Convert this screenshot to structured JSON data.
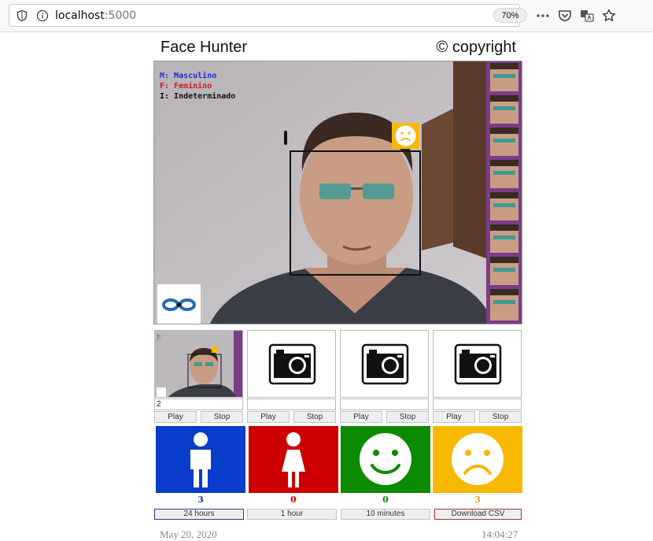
{
  "browser": {
    "url_host": "localhost",
    "url_port": ":5000",
    "zoom": "70%"
  },
  "header": {
    "title": "Face Hunter",
    "copyright": "© copyright"
  },
  "video": {
    "legend": {
      "male": "M: Masculino",
      "female": "F: Feminino",
      "undetermined": "I: Indeterminado"
    },
    "emotion_badge_icon": "sad-face-icon"
  },
  "thumbnails": [
    {
      "input_value": "2",
      "play_label": "Play",
      "stop_label": "Stop"
    },
    {
      "input_value": "",
      "play_label": "Play",
      "stop_label": "Stop"
    },
    {
      "input_value": "",
      "play_label": "Play",
      "stop_label": "Stop"
    },
    {
      "input_value": "",
      "play_label": "Play",
      "stop_label": "Stop"
    }
  ],
  "stats": {
    "male": {
      "count": "3",
      "color": "#0a3ccc",
      "icon": "male-person-icon"
    },
    "female": {
      "count": "0",
      "color": "#cc0000",
      "icon": "female-person-icon"
    },
    "happy": {
      "count": "0",
      "color": "#0c8a00",
      "icon": "happy-face-icon"
    },
    "sad": {
      "count": "3",
      "color": "#f6b900",
      "icon": "sad-face-icon"
    }
  },
  "time_ranges": {
    "day": "24 hours",
    "hour": "1 hour",
    "minutes": "10 minutes",
    "download": "Download CSV"
  },
  "footer": {
    "date": "May 20, 2020",
    "time": "14:04:27"
  }
}
